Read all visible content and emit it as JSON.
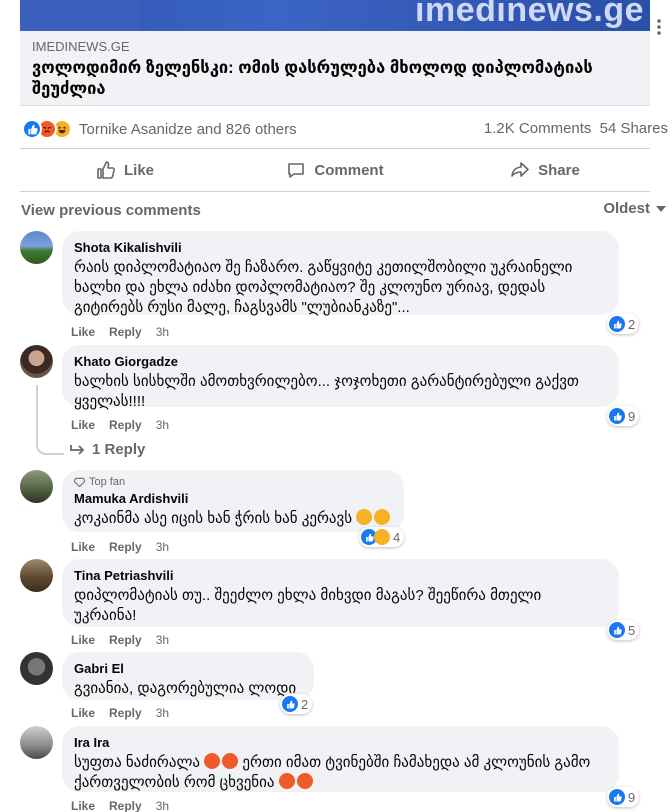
{
  "hero": {
    "site_text": "imedinews.ge"
  },
  "preview": {
    "source": "IMEDINEWS.GE",
    "headline": "ვოლოდიმირ ზელენსკი: ომის დასრულება მხოლოდ დიპლომატიას შეუძლია"
  },
  "reactions": {
    "names": "Tornike Asanidze and 826 others",
    "comments": "1.2K Comments",
    "shares": "54 Shares"
  },
  "actions": {
    "like": "Like",
    "comment": "Comment",
    "share": "Share"
  },
  "comments_header": {
    "view_previous": "View previous comments",
    "sort": "Oldest"
  },
  "comments": [
    {
      "author": "Shota Kikalishvili",
      "text": "რაის დიპლომატიაო შე ჩაზარო. გაწყვიტე კეთილშობილი უკრაინელი ხალხი და ეხლა იძახი დოპლომატიაო? შე კლოუნო ურიავ, დედას გიტირებს რუსი მალე, ჩაგსვამს \"ლუბიანკაზე\"...",
      "like": "Like",
      "reply": "Reply",
      "time": "3h",
      "reaction_count": "2"
    },
    {
      "author": "Khato Giorgadze",
      "text": "ხალხის სისხლში ამოთხვრილებო... ჯოჯოხეთი გარანტირებული გაქვთ ყველას!!!!",
      "like": "Like",
      "reply": "Reply",
      "time": "3h",
      "reaction_count": "9",
      "replies": "1 Reply"
    },
    {
      "badge": "Top fan",
      "author": "Mamuka Ardishvili",
      "text": "კოკაინმა ასე იცის ხან ჭრის ხან კერავს",
      "like": "Like",
      "reply": "Reply",
      "time": "3h",
      "reaction_count": "4"
    },
    {
      "author": "Tina Petriashvili",
      "text": "დიპლომატიას თუ.. შეეძლო ეხლა მიხვდი მაგას? შეეწირა მთელი უკრაინა!",
      "like": "Like",
      "reply": "Reply",
      "time": "3h",
      "reaction_count": "5"
    },
    {
      "author": "Gabri El",
      "text": "გვიანია, დაგორებულია ლოდი",
      "like": "Like",
      "reply": "Reply",
      "time": "3h",
      "reaction_count": "2"
    },
    {
      "author": "Ira Ira",
      "text_a": "სუფთა ნაძირალა",
      "text_b": "ერთი იმათ ტვინებში ჩამახედა ამ კლოუნის გამო ქართველობის რომ ცხვენია",
      "like": "Like",
      "reply": "Reply",
      "time": "3h",
      "reaction_count": "9"
    }
  ],
  "colors": {
    "accent": "#1877f2",
    "muted": "#65676b",
    "bubble": "#f0f2f5",
    "angry": "#f05a28",
    "haha": "#f7b125"
  }
}
